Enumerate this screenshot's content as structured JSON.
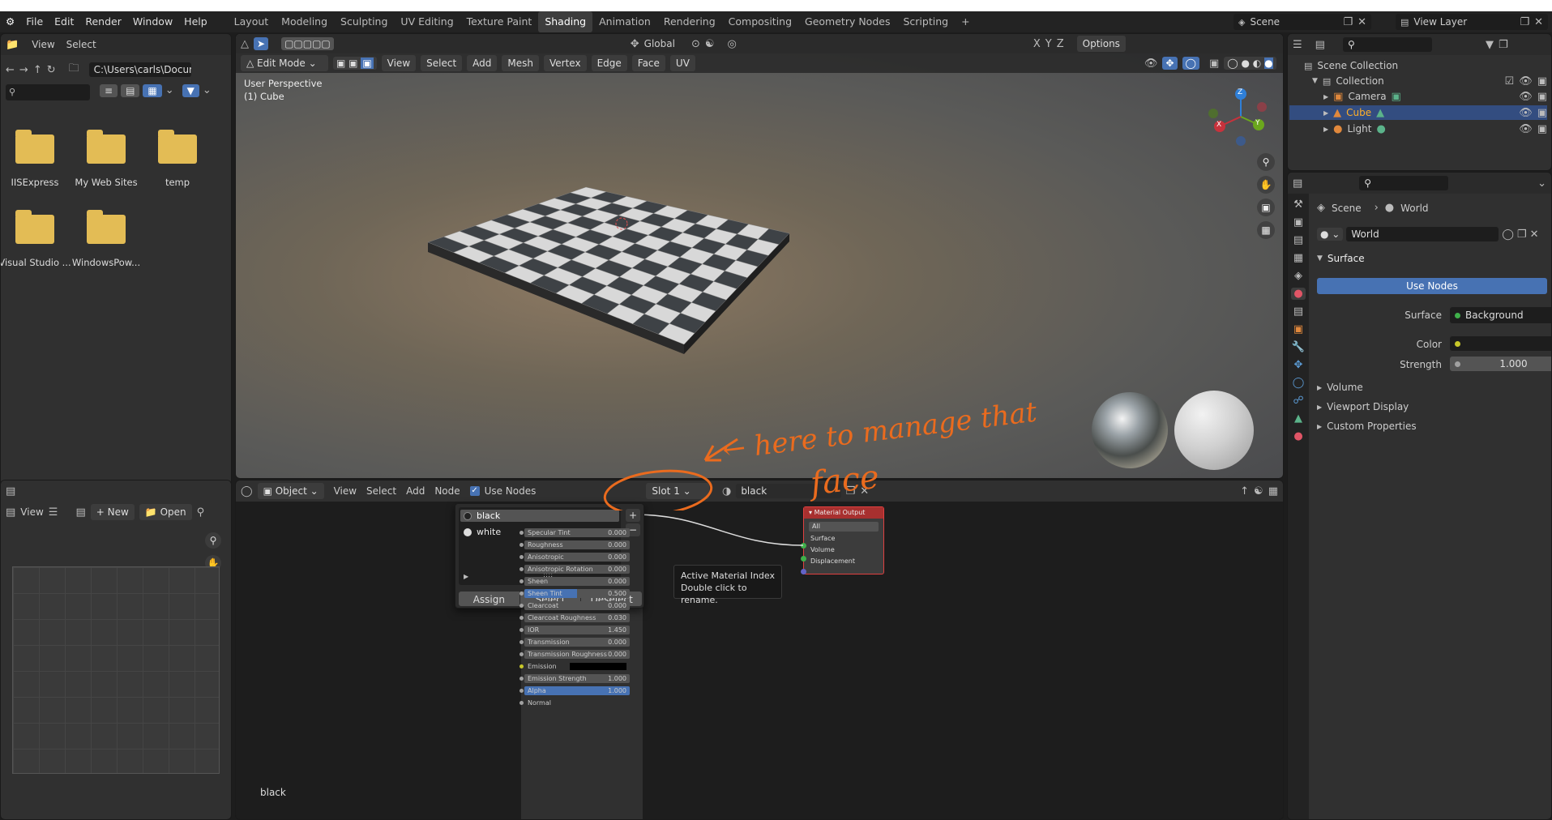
{
  "menu": {
    "items": [
      "File",
      "Edit",
      "Render",
      "Window",
      "Help"
    ],
    "workspaces": [
      "Layout",
      "Modeling",
      "Sculpting",
      "UV Editing",
      "Texture Paint",
      "Shading",
      "Animation",
      "Rendering",
      "Compositing",
      "Geometry Nodes",
      "Scripting"
    ],
    "active_workspace": "Shading",
    "scene": "Scene",
    "view_layer": "View Layer"
  },
  "filebrowser": {
    "view": "View",
    "select": "Select",
    "path": "C:\\Users\\carls\\Docum...",
    "items": [
      "IISExpress",
      "My Web Sites",
      "temp",
      "Visual Studio ...",
      "WindowsPow..."
    ]
  },
  "viewport": {
    "mode": "Edit Mode",
    "menus": [
      "View",
      "Select",
      "Add",
      "Mesh",
      "Vertex",
      "Edge",
      "Face",
      "UV"
    ],
    "orientation": "Global",
    "options": "Options",
    "perspective": "User Perspective",
    "object": "(1) Cube",
    "gizmo": {
      "x": "X",
      "y": "Y",
      "z": "Z"
    }
  },
  "annotation": {
    "arrow_text": "← here to manage that",
    "face_text": "face"
  },
  "node_editor": {
    "object": "Object",
    "menus": [
      "View",
      "Select",
      "Add",
      "Node"
    ],
    "use_nodes": "Use Nodes",
    "slot": "Slot 1",
    "material": "black",
    "bottom_label": "black"
  },
  "slot_popup": {
    "materials": [
      "black",
      "white"
    ],
    "assign": "Assign",
    "select": "Select",
    "deselect": "Deselect",
    "tooltip_title": "Active Material Index",
    "tooltip_body": "Double click to rename."
  },
  "material_output": {
    "title": "Material Output",
    "target": "All",
    "sockets": [
      "Surface",
      "Volume",
      "Displacement"
    ]
  },
  "bsdf_rows": [
    {
      "label": "Specular Tint",
      "value": "0.000"
    },
    {
      "label": "Roughness",
      "value": "0.000"
    },
    {
      "label": "Anisotropic",
      "value": "0.000"
    },
    {
      "label": "Anisotropic Rotation",
      "value": "0.000"
    },
    {
      "label": "Sheen",
      "value": "0.000"
    },
    {
      "label": "Sheen Tint",
      "value": "0.500"
    },
    {
      "label": "Clearcoat",
      "value": "0.000"
    },
    {
      "label": "Clearcoat Roughness",
      "value": "0.030"
    },
    {
      "label": "IOR",
      "value": "1.450"
    },
    {
      "label": "Transmission",
      "value": "0.000"
    },
    {
      "label": "Transmission Roughness",
      "value": "0.000"
    },
    {
      "label": "Emission",
      "value": ""
    },
    {
      "label": "Emission Strength",
      "value": "1.000"
    },
    {
      "label": "Alpha",
      "value": "1.000"
    },
    {
      "label": "Normal",
      "value": ""
    }
  ],
  "image_editor": {
    "view": "View",
    "new": "New",
    "open": "Open"
  },
  "outliner": {
    "root": "Scene Collection",
    "collection": "Collection",
    "items": [
      "Camera",
      "Cube",
      "Light"
    ]
  },
  "properties": {
    "breadcrumb_scene": "Scene",
    "breadcrumb_world": "World",
    "world": "World",
    "surface_panel": "Surface",
    "use_nodes": "Use Nodes",
    "surface_label": "Surface",
    "surface_value": "Background",
    "color_label": "Color",
    "strength_label": "Strength",
    "strength_value": "1.000",
    "sections": [
      "Volume",
      "Viewport Display",
      "Custom Properties"
    ]
  },
  "colors": {
    "accent": "#4772b3",
    "annotation": "#ea6b1e",
    "folder": "#e3bc55"
  }
}
